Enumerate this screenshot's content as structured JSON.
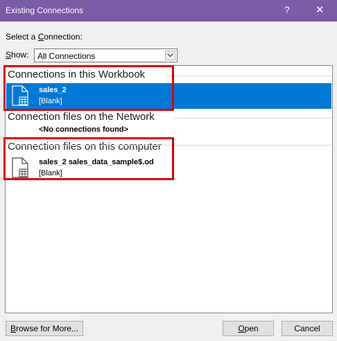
{
  "window": {
    "title": "Existing Connections",
    "help_glyph": "?",
    "close_glyph": "✕"
  },
  "select_connection": {
    "prefix": "Select a ",
    "accesskey": "C",
    "suffix": "onnection:"
  },
  "show": {
    "accesskey": "S",
    "suffix": "how:",
    "selected": "All Connections"
  },
  "groups": {
    "workbook": {
      "header": "Connections in this Workbook",
      "items": [
        {
          "name": "sales_2",
          "desc": "[Blank]",
          "icon": "connection-file-icon"
        }
      ]
    },
    "network": {
      "header": "Connection files on the Network",
      "empty_text": "<No connections found>"
    },
    "computer": {
      "header": "Connection files on this computer",
      "items": [
        {
          "name": "sales_2 sales_data_sample$.od",
          "desc": "[Blank]",
          "icon": "connection-file-icon"
        }
      ]
    }
  },
  "buttons": {
    "browse": {
      "accesskey": "B",
      "suffix": "rowse for More..."
    },
    "open": {
      "accesskey": "O",
      "suffix": "pen"
    },
    "cancel": "Cancel"
  },
  "colors": {
    "titlebar": "#7b5aa6",
    "selection": "#0078d7",
    "highlight_box": "#e00000"
  }
}
